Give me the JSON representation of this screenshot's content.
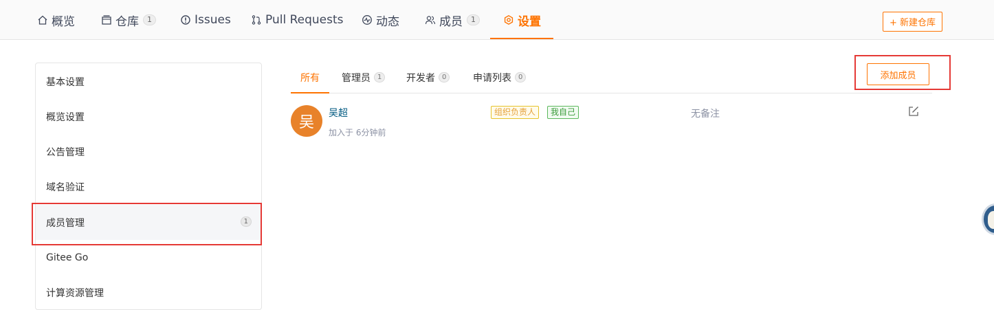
{
  "topnav": {
    "items": [
      {
        "label": "概览",
        "icon": "home-icon",
        "count": null
      },
      {
        "label": "仓库",
        "icon": "repo-icon",
        "count": "1"
      },
      {
        "label": "Issues",
        "icon": "issue-icon",
        "count": null
      },
      {
        "label": "Pull Requests",
        "icon": "pull-request-icon",
        "count": null
      },
      {
        "label": "动态",
        "icon": "activity-icon",
        "count": null
      },
      {
        "label": "成员",
        "icon": "members-icon",
        "count": "1"
      },
      {
        "label": "设置",
        "icon": "settings-icon",
        "count": null,
        "active": true
      }
    ],
    "new_repo_label": "+ 新建仓库"
  },
  "sidebar": {
    "items": [
      {
        "label": "基本设置"
      },
      {
        "label": "概览设置"
      },
      {
        "label": "公告管理"
      },
      {
        "label": "域名验证"
      },
      {
        "label": "成员管理",
        "count": "1",
        "active": true
      },
      {
        "label": "Gitee Go"
      },
      {
        "label": "计算资源管理"
      }
    ]
  },
  "tabs": [
    {
      "label": "所有",
      "active": true
    },
    {
      "label": "管理员",
      "count": "1"
    },
    {
      "label": "开发者",
      "count": "0"
    },
    {
      "label": "申请列表",
      "count": "0"
    }
  ],
  "add_member_label": "添加成员",
  "member": {
    "avatar_text": "吴",
    "name": "吴超",
    "joined": "加入于 6分钟前",
    "tags": [
      "组织负责人",
      "我自己"
    ],
    "remark": "无备注"
  },
  "colors": {
    "accent": "#fe7300",
    "highlight": "#e53935",
    "avatar": "#e8822a"
  }
}
